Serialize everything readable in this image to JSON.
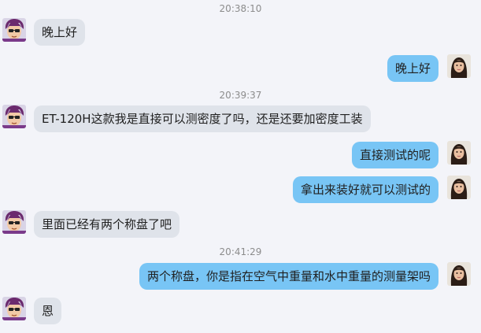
{
  "messages": [
    {
      "type": "time",
      "text": "20:38:10"
    },
    {
      "type": "in",
      "text": "晚上好"
    },
    {
      "type": "out",
      "text": "晚上好"
    },
    {
      "type": "time",
      "text": "20:39:37"
    },
    {
      "type": "in",
      "text": "ET-120H这款我是直接可以测密度了吗，还是还要加密度工装"
    },
    {
      "type": "out",
      "text": "直接测试的呢"
    },
    {
      "type": "out",
      "text": "拿出来装好就可以测试的"
    },
    {
      "type": "in",
      "text": "里面已经有两个称盘了吧"
    },
    {
      "type": "time",
      "text": "20:41:29"
    },
    {
      "type": "out",
      "text": "两个称盘，你是指在空气中重量和水中重量的测量架吗"
    },
    {
      "type": "in",
      "text": "恩"
    }
  ],
  "avatars": {
    "incoming": "cartoon-avatar-icon",
    "outgoing": "user-photo-avatar"
  },
  "colors": {
    "background": "#f3f4f9",
    "incoming_bubble": "#dfe3ea",
    "outgoing_bubble": "#78c5f5",
    "timestamp": "#8c8c8c"
  }
}
